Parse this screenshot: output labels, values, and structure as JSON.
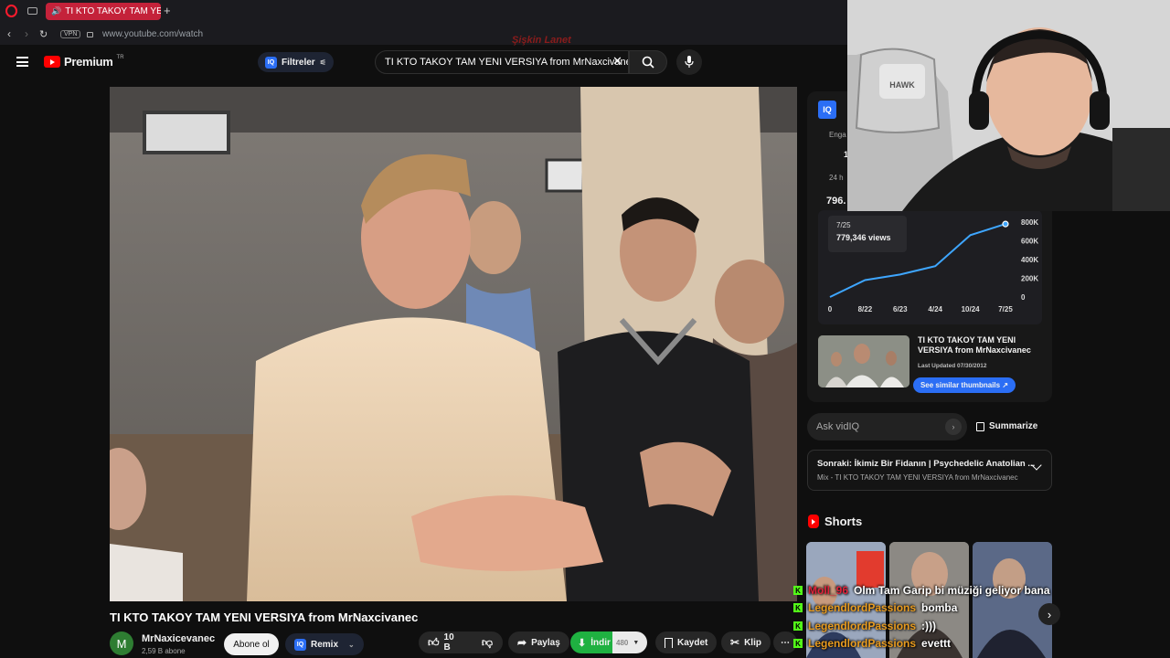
{
  "browser": {
    "tab_title": "TI KTO TAKOY TAM YE",
    "url": "www.youtube.com/watch",
    "vpn_label": "VPN"
  },
  "yt_header": {
    "brand": "Premium",
    "brand_sup": "TR",
    "filters_label": "Filtreler",
    "iq_badge": "IQ",
    "search_value": "TI KTO TAKOY TAM YENI VERSIYA from MrNaxcivanec",
    "watermark": "Şişkin Lanet"
  },
  "video": {
    "title": "TI KTO TAKOY TAM YENI VERSIYA from MrNaxcivanec"
  },
  "channel": {
    "avatar_letter": "M",
    "name": "MrNaxicevanec",
    "subs": "2,59 B abone",
    "subscribe_label": "Abone ol",
    "remix_label": "Remix"
  },
  "actions": {
    "likes": "10 B",
    "share": "Paylaş",
    "download": "İndir",
    "quality": "480",
    "save": "Kaydet",
    "clip": "Klip"
  },
  "iq_panel": {
    "badge": "IQ",
    "eng_label": "Enga",
    "row_value": "1",
    "period_label": "24 h",
    "views_prefix": "796.",
    "tooltip_date": "7/25",
    "tooltip_views": "779,346 views",
    "related_title": "TI KTO TAKOY TAM YENI VERSIYA from MrNaxcivanec",
    "last_updated": "Last Updated 07/30/2012",
    "similar_button": "See similar thumbnails ↗"
  },
  "chart_data": {
    "type": "line",
    "x": [
      "0",
      "8/22",
      "6/23",
      "4/24",
      "10/24",
      "7/25"
    ],
    "series": [
      {
        "values": [
          0,
          180000,
          240000,
          330000,
          660000,
          779346
        ]
      }
    ],
    "yticks": [
      "800K",
      "600K",
      "400K",
      "200K",
      "0"
    ],
    "ylim": [
      0,
      800000
    ]
  },
  "ask": {
    "placeholder": "Ask vidIQ",
    "summarize": "Summarize"
  },
  "next_up": {
    "title": "Sonraki: İkimiz Bir Fidanın | Psychedelic Anatolian ...",
    "subtitle": "Mix - TI KTO TAKOY TAM YENI VERSIYA from MrNaxcivanec"
  },
  "shorts": {
    "title": "Shorts"
  },
  "chat": [
    {
      "user": "Moll_96",
      "message": "Olm Tam Garip bi müziği geliyor bana"
    },
    {
      "user": "LegendlordPassions",
      "message": "bomba"
    },
    {
      "user": "LegendlordPassions",
      "message": ":)))"
    },
    {
      "user": "LegendlordPassions",
      "message": "evettt"
    }
  ],
  "colors": {
    "youtube_red": "#ff0000",
    "accent_blue": "#2b6ef5",
    "download_green": "#1fb141",
    "chat_name": "#e89b1e",
    "kick_green": "#53fc18"
  }
}
